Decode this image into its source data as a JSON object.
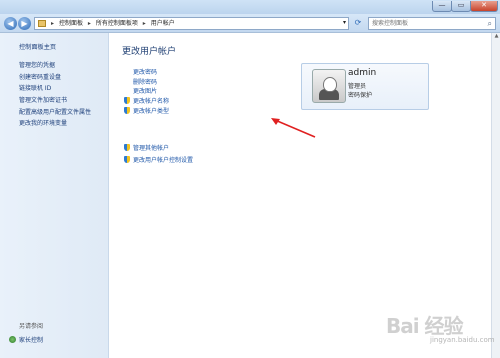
{
  "window": {
    "min_label": "—",
    "max_label": "▭",
    "close_label": "✕"
  },
  "nav": {
    "back_glyph": "◀",
    "forward_glyph": "▶",
    "breadcrumbs": [
      "控制面板",
      "所有控制面板项",
      "用户帐户"
    ],
    "separator": "▸",
    "search_placeholder": "搜索控制面板"
  },
  "left": {
    "home": "控制面板主页",
    "links": [
      "管理您的凭据",
      "创建密码重设盘",
      "链接联机 ID",
      "管理文件加密证书",
      "配置高级用户配置文件属性",
      "更改我的环境变量"
    ],
    "see_also": "另请参阅",
    "parental": "家长控制"
  },
  "main": {
    "title": "更改用户帐户",
    "actions": [
      "更改密码",
      "删除密码",
      "更改图片",
      "更改帐户名称",
      "更改帐户类型"
    ],
    "admin_actions": [
      "管理其他帐户",
      "更改用户帐户控制设置"
    ]
  },
  "user": {
    "name": "admin",
    "role": "管理员",
    "password_state": "密码保护"
  },
  "watermark": {
    "brand": "Bai 经验",
    "url": "jingyan.baidu.com"
  },
  "colors": {
    "link": "#1d56a8",
    "accent_red": "#e02020",
    "title": "#1f3f73"
  }
}
